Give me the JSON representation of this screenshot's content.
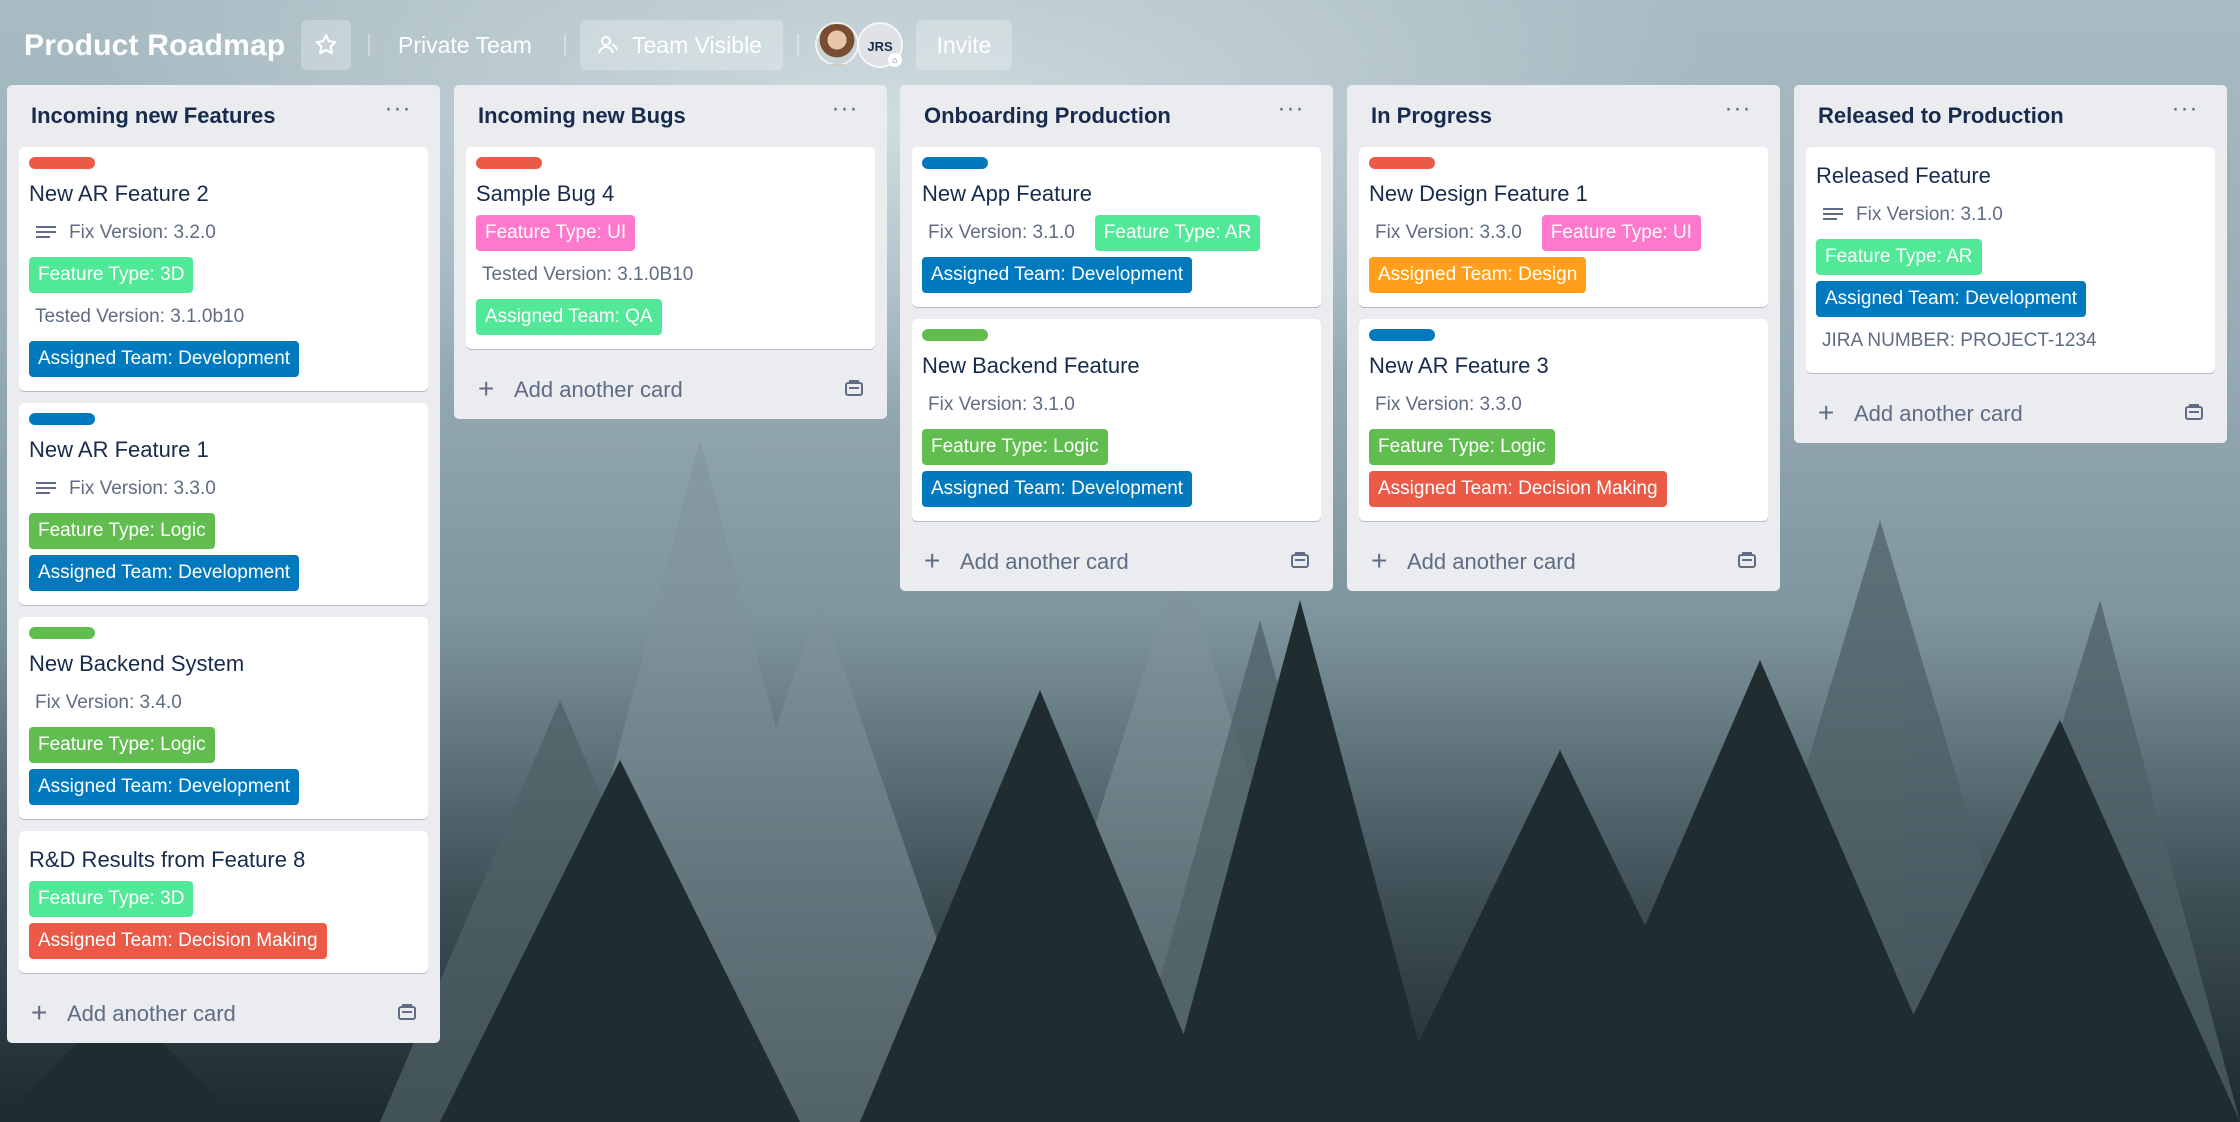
{
  "board": {
    "title": "Product Roadmap",
    "private_label": "Private Team",
    "visible_label": "Team Visible",
    "invite_label": "Invite",
    "member_initials": "JRS"
  },
  "colors": {
    "red": "#eb5a46",
    "blue": "#0079bf",
    "green": "#61bd4f",
    "mint": "#51e898",
    "pink": "#ff78cb",
    "orange": "#ff9f1a",
    "navy": "#0079bf"
  },
  "add_card_label": "Add another card",
  "lists": [
    {
      "title": "Incoming new Features",
      "cards": [
        {
          "strip": "#eb5a46",
          "title": "New AR Feature 2",
          "rows": [
            {
              "desc": true,
              "meta": "Fix Version: 3.2.0",
              "labels": []
            },
            {
              "labels": [
                {
                  "text": "Feature Type: 3D",
                  "color": "#51e898"
                }
              ]
            },
            {
              "meta": "Tested Version: 3.1.0b10",
              "labels": []
            },
            {
              "labels": [
                {
                  "text": "Assigned Team: Development",
                  "color": "#0079bf"
                }
              ]
            }
          ]
        },
        {
          "strip": "#0079bf",
          "title": "New AR Feature 1",
          "rows": [
            {
              "desc": true,
              "meta": "Fix Version: 3.3.0",
              "labels": []
            },
            {
              "labels": [
                {
                  "text": "Feature Type: Logic",
                  "color": "#61bd4f"
                }
              ]
            },
            {
              "labels": [
                {
                  "text": "Assigned Team: Development",
                  "color": "#0079bf"
                }
              ]
            }
          ]
        },
        {
          "strip": "#61bd4f",
          "title": "New Backend System",
          "rows": [
            {
              "meta": "Fix Version: 3.4.0",
              "labels": []
            },
            {
              "labels": [
                {
                  "text": "Feature Type: Logic",
                  "color": "#61bd4f"
                }
              ]
            },
            {
              "labels": [
                {
                  "text": "Assigned Team: Development",
                  "color": "#0079bf"
                }
              ]
            }
          ]
        },
        {
          "strip": "",
          "title": "R&D Results from Feature 8",
          "rows": [
            {
              "labels": [
                {
                  "text": "Feature Type: 3D",
                  "color": "#51e898"
                }
              ]
            },
            {
              "labels": [
                {
                  "text": "Assigned Team: Decision Making",
                  "color": "#eb5a46"
                }
              ]
            }
          ]
        }
      ]
    },
    {
      "title": "Incoming new Bugs",
      "cards": [
        {
          "strip": "#eb5a46",
          "title": "Sample Bug 4",
          "rows": [
            {
              "labels": [
                {
                  "text": "Feature Type: UI",
                  "color": "#ff78cb"
                }
              ]
            },
            {
              "meta": "Tested Version: 3.1.0B10",
              "labels": []
            },
            {
              "labels": [
                {
                  "text": "Assigned Team: QA",
                  "color": "#51e898"
                }
              ]
            }
          ]
        }
      ]
    },
    {
      "title": "Onboarding Production",
      "cards": [
        {
          "strip": "#0079bf",
          "title": "New App Feature",
          "rows": [
            {
              "meta": "Fix Version: 3.1.0",
              "labels": [
                {
                  "text": "Feature Type: AR",
                  "color": "#51e898"
                }
              ]
            },
            {
              "labels": [
                {
                  "text": "Assigned Team: Development",
                  "color": "#0079bf"
                }
              ]
            }
          ]
        },
        {
          "strip": "#61bd4f",
          "title": "New Backend Feature",
          "rows": [
            {
              "meta": "Fix Version: 3.1.0",
              "labels": []
            },
            {
              "labels": [
                {
                  "text": "Feature Type: Logic",
                  "color": "#61bd4f"
                }
              ]
            },
            {
              "labels": [
                {
                  "text": "Assigned Team: Development",
                  "color": "#0079bf"
                }
              ]
            }
          ]
        }
      ]
    },
    {
      "title": "In Progress",
      "cards": [
        {
          "strip": "#eb5a46",
          "title": "New Design Feature 1",
          "rows": [
            {
              "meta": "Fix Version: 3.3.0",
              "labels": [
                {
                  "text": "Feature Type: UI",
                  "color": "#ff78cb"
                }
              ]
            },
            {
              "labels": [
                {
                  "text": "Assigned Team: Design",
                  "color": "#ff9f1a"
                }
              ]
            }
          ]
        },
        {
          "strip": "#0079bf",
          "title": "New AR Feature 3",
          "rows": [
            {
              "meta": "Fix Version: 3.3.0",
              "labels": []
            },
            {
              "labels": [
                {
                  "text": "Feature Type: Logic",
                  "color": "#61bd4f"
                }
              ]
            },
            {
              "labels": [
                {
                  "text": "Assigned Team: Decision Making",
                  "color": "#eb5a46"
                }
              ]
            }
          ]
        }
      ]
    },
    {
      "title": "Released to Production",
      "cards": [
        {
          "strip": "",
          "title": "Released Feature",
          "rows": [
            {
              "desc": true,
              "meta": "Fix Version: 3.1.0",
              "labels": []
            },
            {
              "labels": [
                {
                  "text": "Feature Type: AR",
                  "color": "#51e898"
                }
              ]
            },
            {
              "labels": [
                {
                  "text": "Assigned Team: Development",
                  "color": "#0079bf"
                }
              ]
            },
            {
              "meta": "JIRA NUMBER: PROJECT-1234",
              "labels": []
            }
          ]
        }
      ]
    }
  ]
}
